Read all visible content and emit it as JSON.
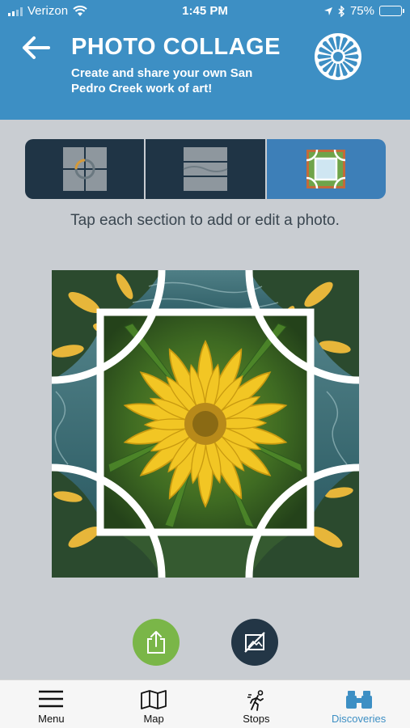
{
  "status_bar": {
    "carrier": "Verizon",
    "time": "1:45 PM",
    "battery": "75%",
    "battery_level": 0.75
  },
  "header": {
    "title": "PHOTO COLLAGE",
    "subtitle": "Create and share your own San Pedro Creek work of art!",
    "back_icon": "arrow-left-icon",
    "logo_icon": "flower-logo-icon"
  },
  "layout_selector": {
    "options": [
      {
        "icon": "grid-four-layout-icon",
        "selected": false
      },
      {
        "icon": "stacked-rows-layout-icon",
        "selected": false
      },
      {
        "icon": "framed-center-layout-icon",
        "selected": true
      }
    ]
  },
  "instruction": "Tap each section to add or edit a photo.",
  "actions": {
    "share_icon": "share-icon",
    "clear_icon": "no-image-icon"
  },
  "tabs": [
    {
      "label": "Menu",
      "icon": "hamburger-icon",
      "active": false
    },
    {
      "label": "Map",
      "icon": "map-icon",
      "active": false
    },
    {
      "label": "Stops",
      "icon": "walking-icon",
      "active": false
    },
    {
      "label": "Discoveries",
      "icon": "binoculars-icon",
      "active": true
    }
  ],
  "colors": {
    "header_blue": "#3d8fc4",
    "segment_dark": "#1f3445",
    "segment_active": "#3d7fb8",
    "share_green": "#7ab648",
    "clear_dark": "#233646",
    "background": "#c9cdd2"
  }
}
